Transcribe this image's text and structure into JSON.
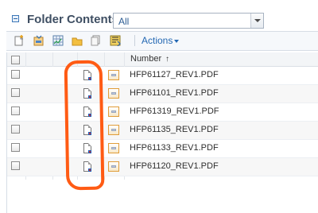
{
  "header": {
    "title": "Folder Contents",
    "filter_value": "All"
  },
  "toolbar": {
    "actions_label": "Actions",
    "icons": [
      "new-document-icon",
      "import-icon",
      "grid-icon",
      "folder-icon",
      "copy-icon",
      "export-icon"
    ]
  },
  "table": {
    "number_header": "Number",
    "sort_indicator": "↑",
    "rows": [
      {
        "number": "HFP61127_REV1.PDF"
      },
      {
        "number": "HFP61101_REV1.PDF"
      },
      {
        "number": "HFP61319_REV1.PDF"
      },
      {
        "number": "HFP61135_REV1.PDF"
      },
      {
        "number": "HFP61133_REV1.PDF"
      },
      {
        "number": "HFP61120_REV1.PDF"
      }
    ]
  },
  "annotation": {
    "color": "#ff5b14"
  }
}
